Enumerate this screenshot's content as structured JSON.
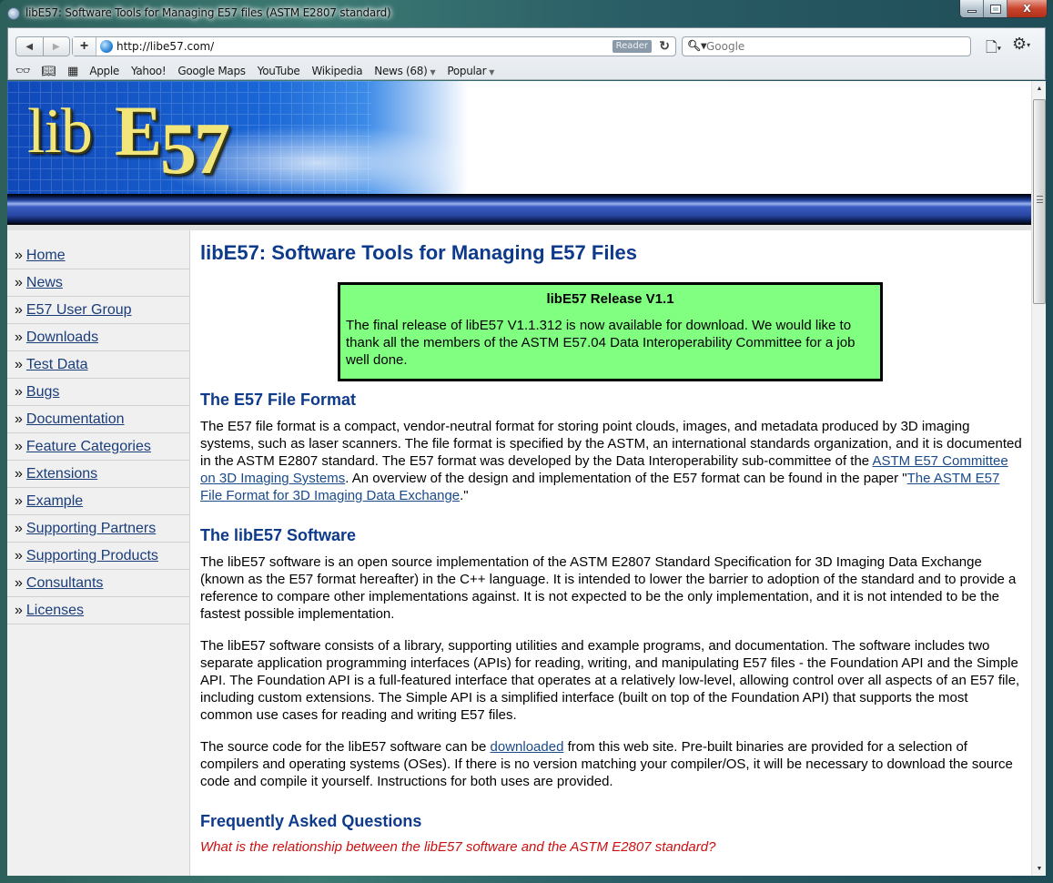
{
  "window": {
    "title": "libE57: Software Tools for Managing E57 files (ASTM E2807 standard)",
    "controls": {
      "minimize": "minimize",
      "maximize": "maximize",
      "close": "X"
    }
  },
  "toolbar": {
    "back_icon": "◀",
    "forward_icon": "▶",
    "add_icon": "+",
    "url": "http://libe57.com/",
    "reader_label": "Reader",
    "reload_icon": "↻",
    "search_icon": "🔍︎▾",
    "search_placeholder": "Google",
    "page_menu_icon": "🗋",
    "gear_menu_icon": "⚙"
  },
  "bookmarks": {
    "reading_list_icon": "👓︎",
    "bookmarks_icon": "📖︎",
    "top_sites_icon": "▦",
    "items": [
      {
        "label": "Apple"
      },
      {
        "label": "Yahoo!"
      },
      {
        "label": "Google Maps"
      },
      {
        "label": "YouTube"
      },
      {
        "label": "Wikipedia"
      },
      {
        "label": "News (68)",
        "dropdown": "▼"
      },
      {
        "label": "Popular",
        "dropdown": "▼"
      }
    ]
  },
  "banner": {
    "logo_lib": "lib",
    "logo_e": "E",
    "logo_57": "57"
  },
  "sidebar": {
    "bullet": "»",
    "items": [
      {
        "label": "Home"
      },
      {
        "label": "News"
      },
      {
        "label": "E57 User Group"
      },
      {
        "label": "Downloads"
      },
      {
        "label": "Test Data"
      },
      {
        "label": "Bugs"
      },
      {
        "label": "Documentation"
      },
      {
        "label": "Feature Categories"
      },
      {
        "label": "Extensions"
      },
      {
        "label": "Example"
      },
      {
        "label": "Supporting Partners"
      },
      {
        "label": "Supporting Products"
      },
      {
        "label": "Consultants"
      },
      {
        "label": "Licenses"
      }
    ]
  },
  "main": {
    "title": "libE57: Software Tools for Managing E57 Files",
    "release": {
      "title": "libE57 Release V1.1",
      "body": "The final release of libE57 V1.1.312 is now available for download. We would like to thank all the members of the ASTM E57.04 Data Interoperability Committee for a job well done."
    },
    "sections": [
      {
        "heading": "The E57 File Format",
        "p1": {
          "text_a": "The E57 file format is a compact, vendor-neutral format for storing point clouds, images, and metadata produced by 3D imaging systems, such as laser scanners. The file format is specified by the ASTM, an international standards organization, and it is documented in the ASTM E2807 standard. The E57 format was developed by the Data Interoperability sub-committee of the ",
          "link_a": "ASTM E57 Committee on 3D Imaging Systems",
          "text_b": ". An overview of the design and implementation of the E57 format can be found in the paper \"",
          "link_b": "The ASTM E57 File Format for 3D Imaging Data Exchange",
          "text_c": ".\""
        }
      },
      {
        "heading": "The libE57 Software",
        "p1": "The libE57 software is an open source implementation of the ASTM E2807 Standard Specification for 3D Imaging Data Exchange (known as the E57 format hereafter) in the C++ language. It is intended to lower the barrier to adoption of the standard and to provide a reference to compare other implementations against. It is not expected to be the only implementation, and it is not intended to be the fastest possible implementation.",
        "p2": "The libE57 software consists of a library, supporting utilities and example programs, and documentation. The software includes two separate application programming interfaces (APIs) for reading, writing, and manipulating E57 files - the Foundation API and the Simple API. The Foundation API is a full-featured interface that operates at a relatively low-level, allowing control over all aspects of an E57 file, including custom extensions. The Simple API is a simplified interface (built on top of the Foundation API) that supports the most common use cases for reading and writing E57 files.",
        "p3": {
          "text_a": "The source code for the libE57 software can be ",
          "link": "downloaded",
          "text_b": " from this web site. Pre-built binaries are provided for a selection of compilers and operating systems (OSes). If there is no version matching your compiler/OS, it will be necessary to download the source code and compile it yourself. Instructions for both uses are provided."
        }
      },
      {
        "heading": "Frequently Asked Questions",
        "question": "What is the relationship between the libE57 software and the ASTM E2807 standard?"
      }
    ]
  },
  "scrollbar": {
    "up_icon": "▲",
    "down_icon": "▼",
    "position_fraction": 0.0
  }
}
